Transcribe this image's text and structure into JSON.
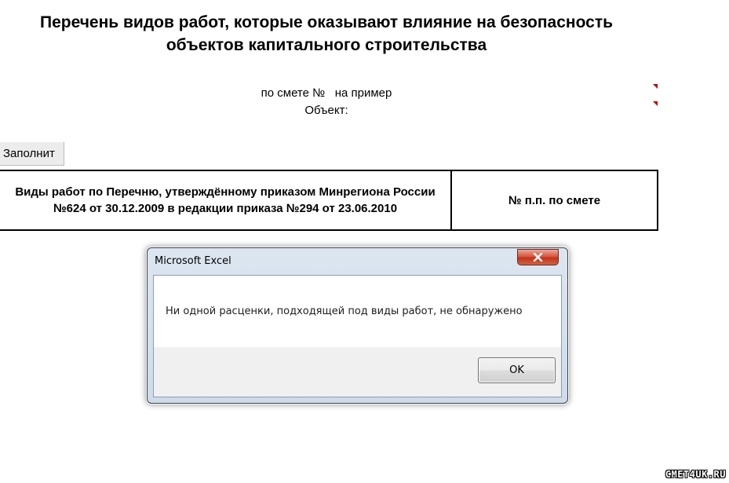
{
  "sheet": {
    "title_line1": "Перечень видов работ, которые оказывают влияние на безопасность",
    "title_line2": "объектов капитального строительства",
    "estimate_label": "по смете №   на пример",
    "object_label": "Объект:",
    "fill_button_label": "Заполнит",
    "table_headers": {
      "works": "Виды работ по Перечню, утверждённому приказом Минрегиона России №624 от 30.12.2009 в редакции приказа №294 от 23.06.2010",
      "estimate_number": "№ п.п. по смете"
    },
    "comment_marker_color": "#c00000"
  },
  "dialog": {
    "title": "Microsoft Excel",
    "message": "Ни одной расценки, подходящей под виды работ, не обнаружено",
    "ok_label": "OK",
    "close_icon": "close-icon"
  },
  "watermark": "CMET4UK.RU"
}
